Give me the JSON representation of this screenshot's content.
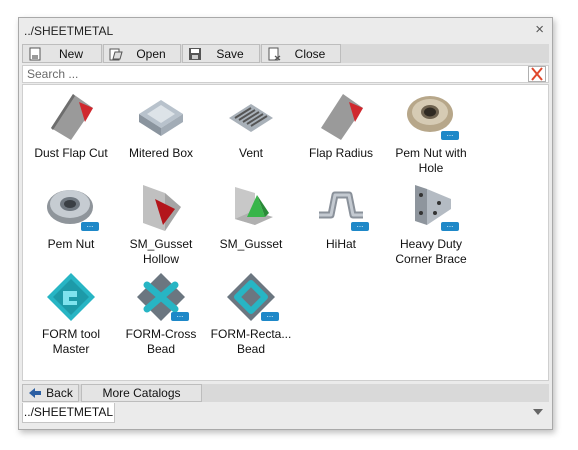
{
  "window": {
    "title": "../SHEETMETAL",
    "close_symbol": "×"
  },
  "toolbar": {
    "new_label": "New",
    "open_label": "Open",
    "save_label": "Save",
    "close_label": "Close"
  },
  "search": {
    "placeholder": "Search ...",
    "value": ""
  },
  "items": [
    {
      "label": "Dust Flap Cut",
      "icon": "dust-flap-cut-icon"
    },
    {
      "label": "Mitered Box",
      "icon": "mitered-box-icon"
    },
    {
      "label": "Vent",
      "icon": "vent-icon"
    },
    {
      "label": "Flap Radius",
      "icon": "flap-radius-icon"
    },
    {
      "label": "Pem Nut with Hole",
      "icon": "pem-nut-with-hole-icon",
      "badge": "..."
    },
    {
      "label": "Pem Nut",
      "icon": "pem-nut-icon",
      "badge": "..."
    },
    {
      "label": "SM_Gusset Hollow",
      "icon": "gusset-hollow-icon"
    },
    {
      "label": "SM_Gusset",
      "icon": "gusset-icon"
    },
    {
      "label": "HiHat",
      "icon": "hihat-icon",
      "badge": "..."
    },
    {
      "label": "Heavy Duty Corner Brace",
      "icon": "corner-brace-icon",
      "badge": "..."
    },
    {
      "label": "FORM tool Master",
      "icon": "form-tool-master-icon"
    },
    {
      "label": "FORM-Cross Bead",
      "icon": "form-cross-bead-icon",
      "badge": "..."
    },
    {
      "label": "FORM-Recta... Bead",
      "icon": "form-rect-bead-icon",
      "badge": "..."
    }
  ],
  "bottombar": {
    "back_label": "Back",
    "more_label": "More Catalogs"
  },
  "tabs": [
    {
      "label": "../SHEETMETAL"
    }
  ],
  "colors": {
    "accent_red": "#d0282e",
    "accent_teal": "#27b5c4",
    "badge_blue": "#1e88c8",
    "gusset_green": "#39b54a"
  }
}
